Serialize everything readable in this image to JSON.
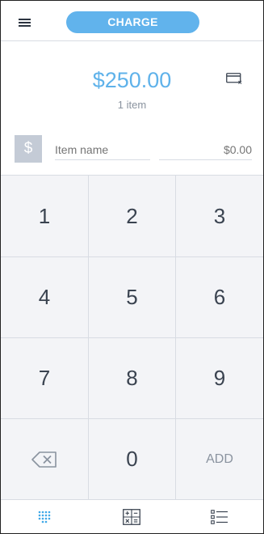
{
  "header": {
    "charge_label": "CHARGE"
  },
  "sale": {
    "total": "$250.00",
    "item_count": "1 item"
  },
  "item_entry": {
    "currency_symbol": "$",
    "name_placeholder": "Item name",
    "price_placeholder": "$0.00"
  },
  "keypad": {
    "keys": [
      "1",
      "2",
      "3",
      "4",
      "5",
      "6",
      "7",
      "8",
      "9",
      "",
      "0",
      "ADD"
    ]
  },
  "colors": {
    "accent": "#61b3ec",
    "keypad_bg": "#f3f4f7",
    "active_nav": "#3fa8e8"
  },
  "icons": {
    "menu": "menu-icon",
    "card": "card-icon",
    "backspace": "backspace-icon",
    "keypad": "keypad-icon",
    "calculator": "calculator-icon",
    "list": "list-icon"
  }
}
